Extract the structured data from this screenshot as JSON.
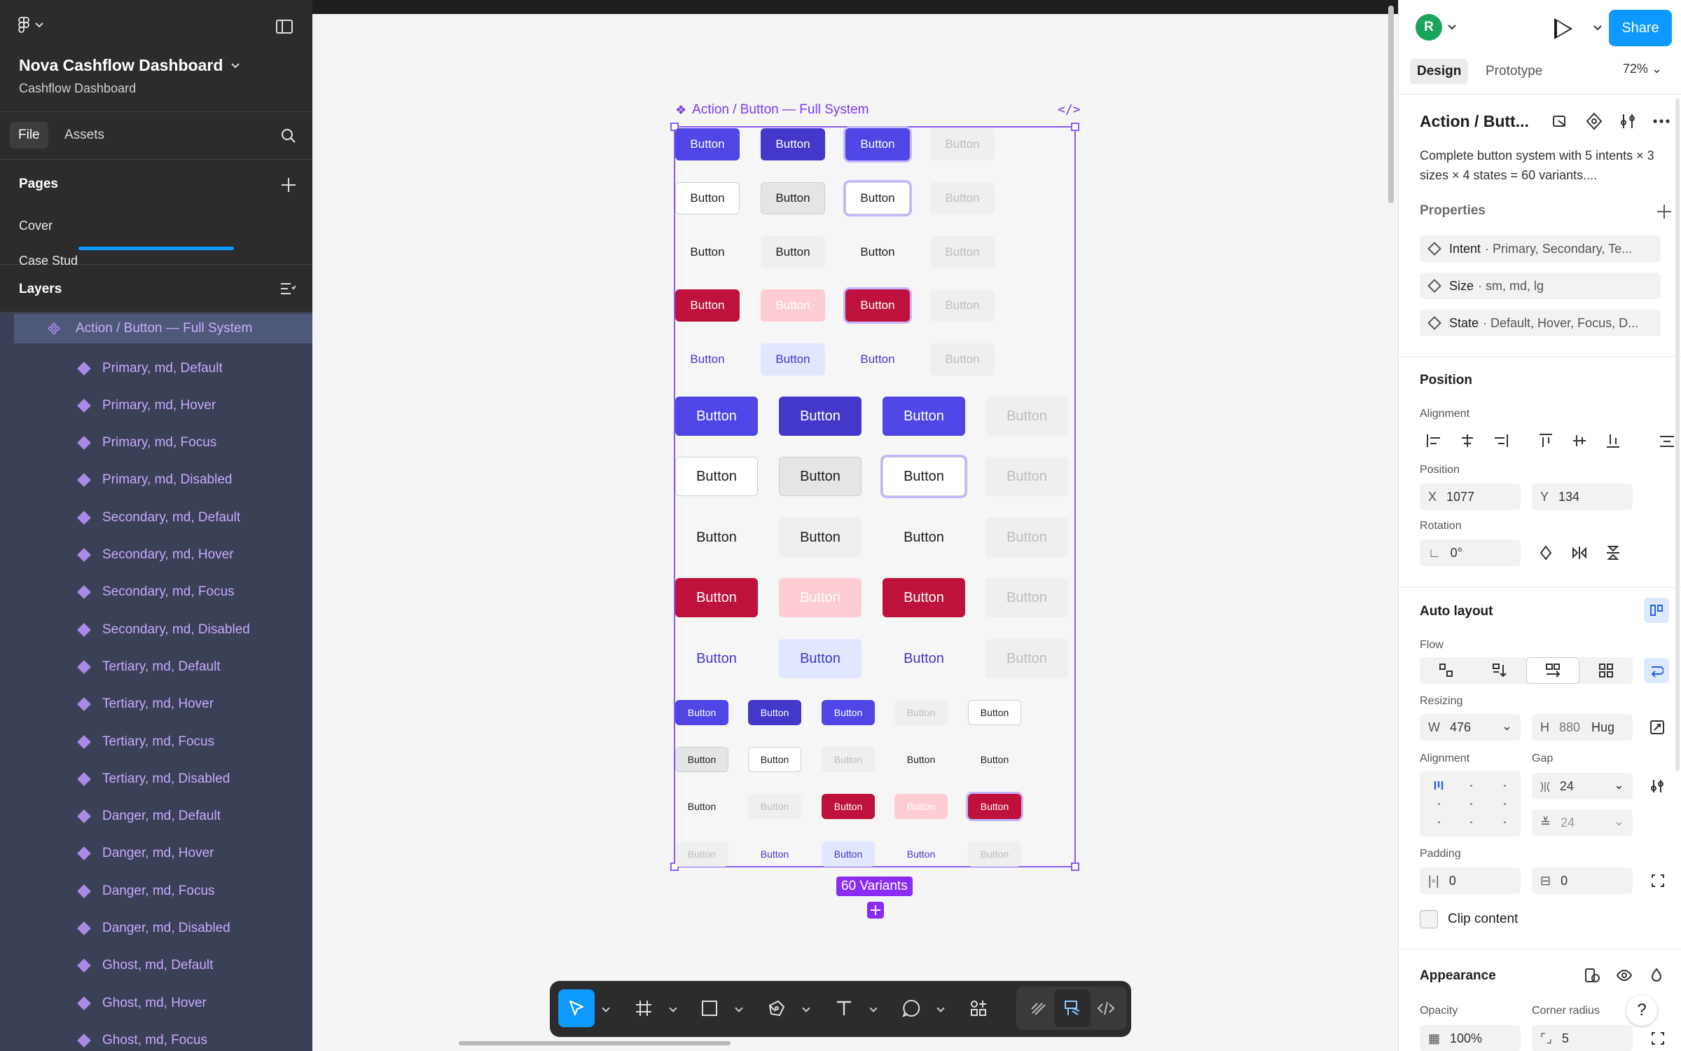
{
  "app": {
    "project_title": "Nova Cashflow Dashboard",
    "project_subtitle": "Cashflow Dashboard",
    "tabs": {
      "file": "File",
      "assets": "Assets"
    }
  },
  "pages": {
    "title": "Pages",
    "items": [
      "Cover",
      "Case Stud"
    ]
  },
  "layers": {
    "title": "Layers",
    "root": "Action / Button — Full System",
    "items": [
      "Primary, md, Default",
      "Primary, md, Hover",
      "Primary, md, Focus",
      "Primary, md, Disabled",
      "Secondary, md, Default",
      "Secondary, md, Hover",
      "Secondary, md, Focus",
      "Secondary, md, Disabled",
      "Tertiary, md, Default",
      "Tertiary, md, Hover",
      "Tertiary, md, Focus",
      "Tertiary, md, Disabled",
      "Danger, md, Default",
      "Danger, md, Hover",
      "Danger, md, Focus",
      "Danger, md, Disabled",
      "Ghost, md, Default",
      "Ghost, md, Hover",
      "Ghost, md, Focus"
    ]
  },
  "canvas": {
    "frame_label": "Action / Button — Full System",
    "button_text": "Button",
    "variants_badge": "60 Variants",
    "colors": {
      "primary": "#4f46e5",
      "primary_hover": "#4338ca",
      "danger": "#be123c",
      "danger_disabled": "#fecdd3",
      "ghost_bg": "#e0e7ff",
      "selection": "#8b5cf6"
    }
  },
  "toolbar": {
    "tools": [
      "move-tool",
      "frame-tool",
      "rectangle-tool",
      "pen-tool",
      "text-tool",
      "comment-tool",
      "actions-tool",
      "draw-mode",
      "design-mode",
      "dev-mode"
    ]
  },
  "right_panel": {
    "avatar_initial": "R",
    "share_label": "Share",
    "tabs": {
      "design": "Design",
      "prototype": "Prototype"
    },
    "zoom": "72%",
    "component_title": "Action / Butt...",
    "component_description": "Complete button system with 5 intents × 3 sizes × 4 states = 60 variants....",
    "properties": {
      "title": "Properties",
      "items": [
        {
          "name": "Intent",
          "values": "· Primary, Secondary, Te..."
        },
        {
          "name": "Size",
          "values": "· sm, md, lg"
        },
        {
          "name": "State",
          "values": "· Default, Hover, Focus, D..."
        }
      ]
    },
    "position": {
      "title": "Position",
      "alignment_label": "Alignment",
      "position_label": "Position",
      "x_label": "X",
      "x": "1077",
      "y_label": "Y",
      "y": "134",
      "rotation_label": "Rotation",
      "rotation": "0°"
    },
    "auto_layout": {
      "title": "Auto layout",
      "flow_label": "Flow",
      "resizing_label": "Resizing",
      "w_label": "W",
      "w": "476",
      "h_label": "H",
      "h": "880",
      "h_mode": "Hug",
      "alignment_label": "Alignment",
      "gap_label": "Gap",
      "gap_h": "24",
      "gap_v": "24",
      "padding_label": "Padding",
      "padding_h": "0",
      "padding_v": "0",
      "clip_label": "Clip content"
    },
    "appearance": {
      "title": "Appearance",
      "opacity_label": "Opacity",
      "opacity": "100%",
      "radius_label": "Corner radius",
      "radius": "5"
    },
    "help": "?"
  }
}
